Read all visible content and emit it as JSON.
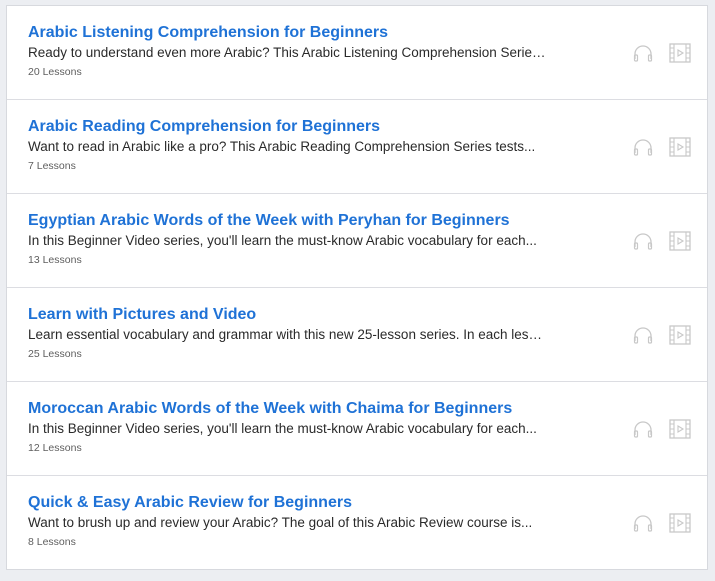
{
  "series": [
    {
      "title": "Arabic Listening Comprehension for Beginners",
      "description": "Ready to understand even more Arabic? This Arabic Listening Comprehension Series helps you...",
      "lessons": "20 Lessons"
    },
    {
      "title": "Arabic Reading Comprehension for Beginners",
      "description": "Want to read in Arabic like a pro? This Arabic Reading Comprehension Series tests...",
      "lessons": "7 Lessons"
    },
    {
      "title": "Egyptian Arabic Words of the Week with Peryhan for Beginners",
      "description": "In this Beginner Video series, you'll learn the must-know Arabic vocabulary for each...",
      "lessons": "13 Lessons"
    },
    {
      "title": "Learn with Pictures and Video",
      "description": "Learn essential vocabulary and grammar with this new 25-lesson series. In each lesson...",
      "lessons": "25 Lessons"
    },
    {
      "title": "Moroccan Arabic Words of the Week with Chaima for Beginners",
      "description": "In this Beginner Video series, you'll learn the must-know Arabic vocabulary for each...",
      "lessons": "12 Lessons"
    },
    {
      "title": "Quick & Easy Arabic Review for Beginners",
      "description": "Want to brush up and review your Arabic? The goal of this Arabic Review course is...",
      "lessons": "8 Lessons"
    }
  ],
  "icons": {
    "audio": "headphones-icon",
    "video": "video-icon"
  },
  "colors": {
    "title": "#1f72d6",
    "icon": "#c8c8c8",
    "background": "#eceef2"
  }
}
